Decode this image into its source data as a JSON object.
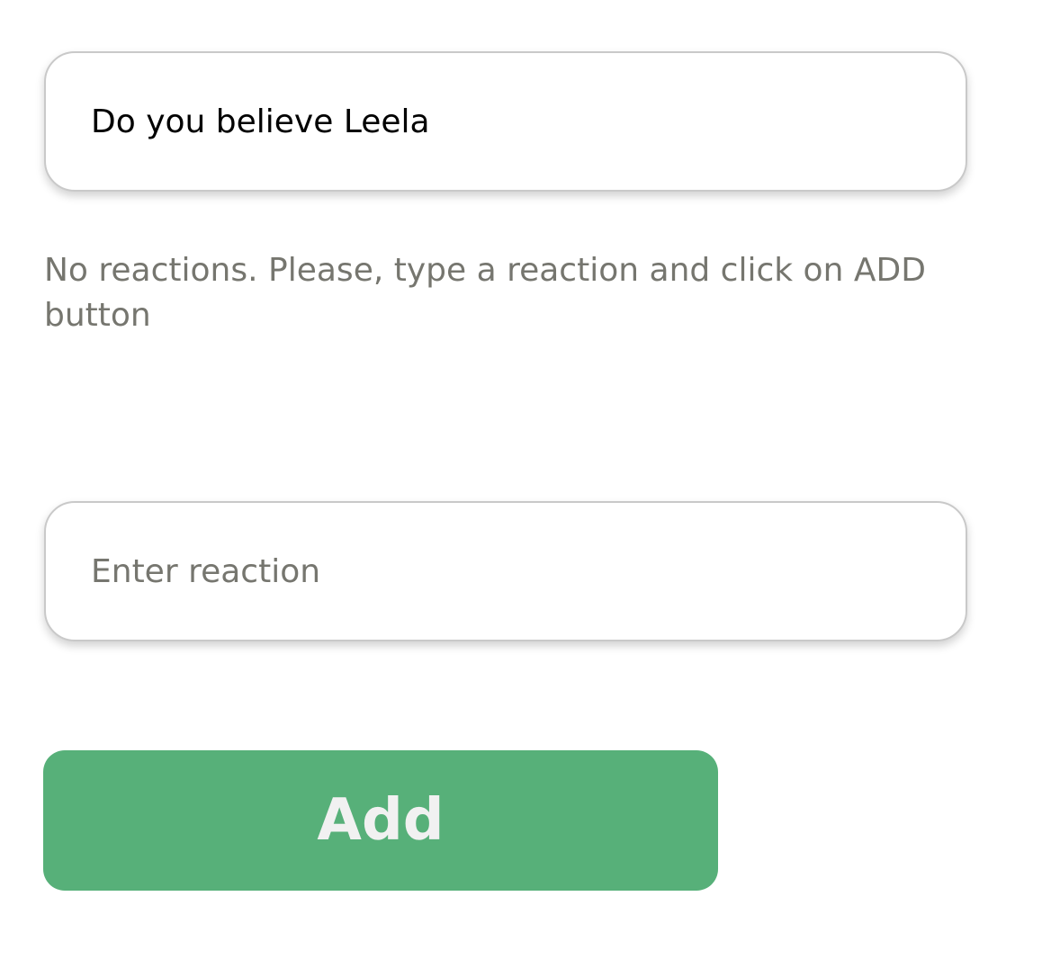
{
  "question_field": {
    "value": "Do you believe Leela"
  },
  "empty_state": {
    "message": "No reactions. Please, type a reaction and click on ADD button"
  },
  "reaction_field": {
    "value": "",
    "placeholder": "Enter reaction"
  },
  "add_button": {
    "label": "Add"
  },
  "colors": {
    "accent": "#57b079",
    "muted_text": "#76766f",
    "border": "#c9c9c9"
  }
}
